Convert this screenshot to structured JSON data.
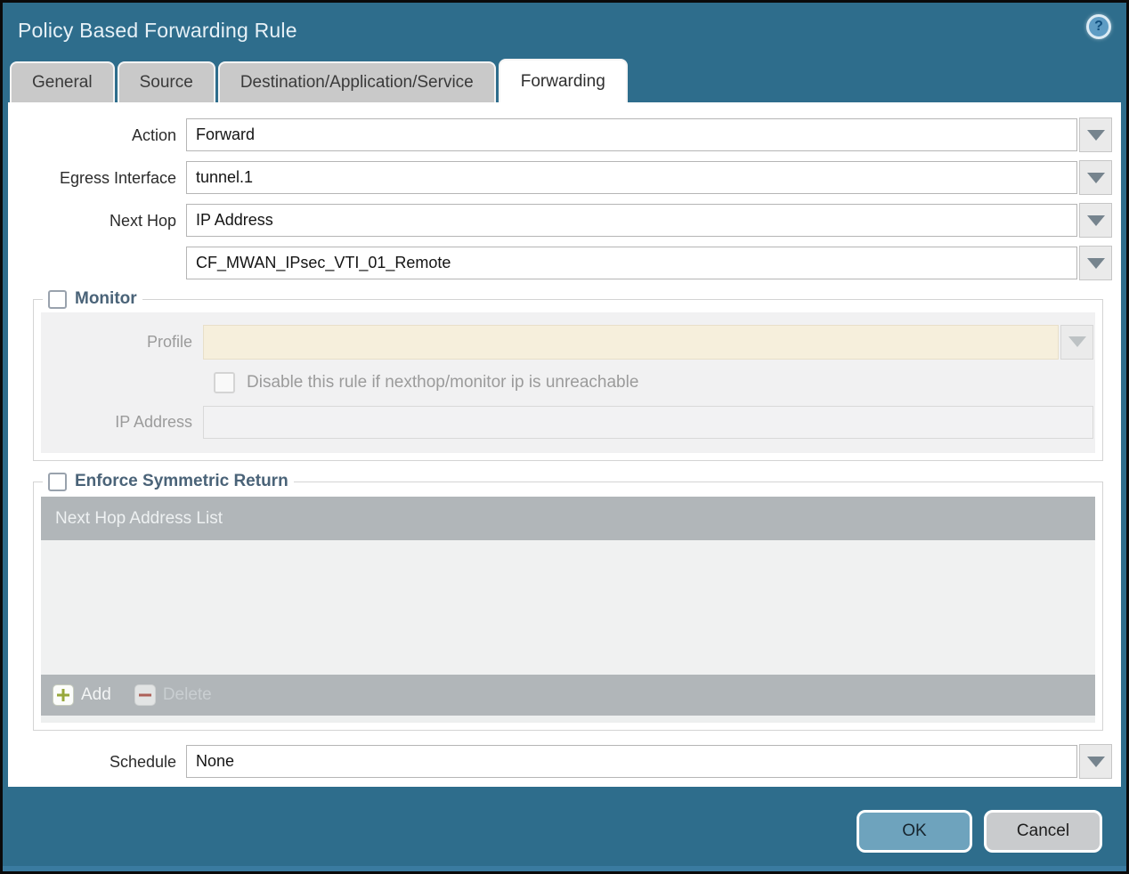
{
  "dialog": {
    "title": "Policy Based Forwarding Rule",
    "help_glyph": "?"
  },
  "tabs": [
    {
      "label": "General",
      "active": false
    },
    {
      "label": "Source",
      "active": false
    },
    {
      "label": "Destination/Application/Service",
      "active": false
    },
    {
      "label": "Forwarding",
      "active": true
    }
  ],
  "form": {
    "action_label": "Action",
    "action_value": "Forward",
    "egress_label": "Egress Interface",
    "egress_value": "tunnel.1",
    "next_hop_label": "Next Hop",
    "next_hop_value": "IP Address",
    "next_hop_address_value": "CF_MWAN_IPsec_VTI_01_Remote",
    "schedule_label": "Schedule",
    "schedule_value": "None"
  },
  "monitor": {
    "legend": "Monitor",
    "checked": false,
    "profile_label": "Profile",
    "profile_value": "",
    "disable_checkbox_label": "Disable this rule if nexthop/monitor ip is unreachable",
    "disable_checkbox_checked": false,
    "ip_label": "IP Address",
    "ip_value": ""
  },
  "symmetric_return": {
    "legend": "Enforce Symmetric Return",
    "checked": false,
    "table_header": "Next Hop Address List",
    "rows": [],
    "add_label": "Add",
    "delete_label": "Delete",
    "delete_enabled": false
  },
  "buttons": {
    "ok": "OK",
    "cancel": "Cancel"
  },
  "colors": {
    "titlebar_teal": "#2e6d8c",
    "active_tab_bg": "#ffffff",
    "inactive_tab_bg": "#c9c9c9",
    "fieldset_legend_text": "#4a6378",
    "monitor_panel_bg": "#f1f1f2",
    "profile_field_cream": "#f6efdc",
    "table_bar_gray": "#b1b6b9",
    "table_body_gray": "#f0f1f1",
    "ok_button_bg": "#6ea3bd",
    "cancel_button_bg": "#c9cbcd",
    "add_plus_green": "#97a83b",
    "delete_minus_red": "#ad6159"
  }
}
